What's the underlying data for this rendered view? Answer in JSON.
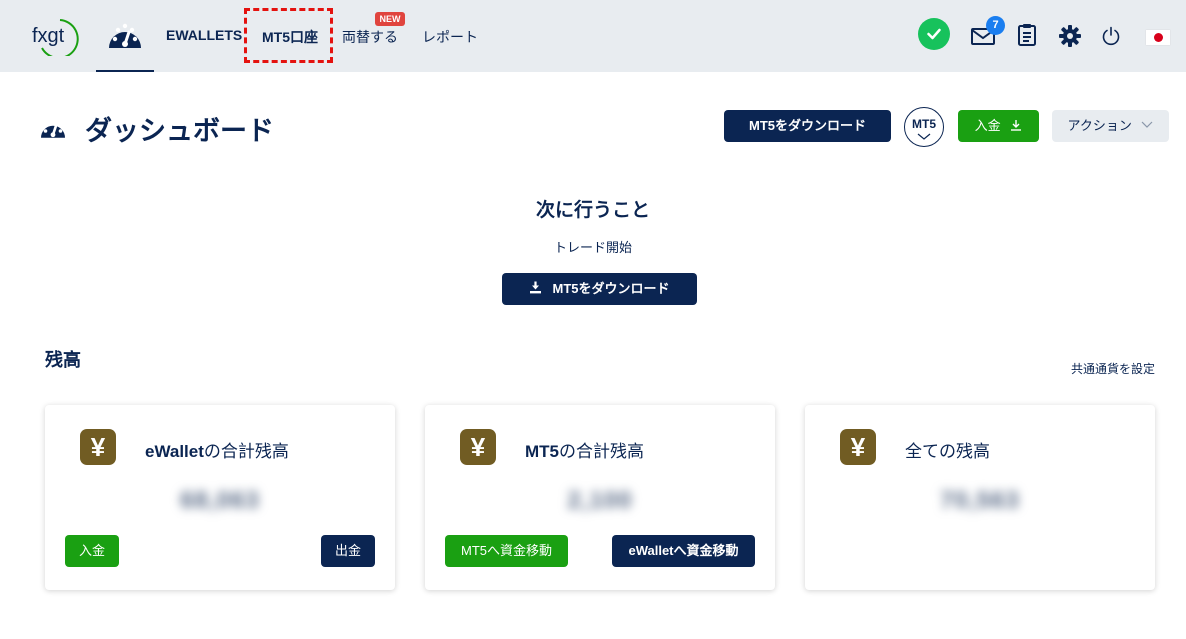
{
  "nav": {
    "logo_text": "fxgt",
    "ewallets": "EWALLETS",
    "mt5_accounts": "MT5口座",
    "exchange": "両替する",
    "exchange_badge": "NEW",
    "reports": "レポート",
    "mail_count": "7"
  },
  "header": {
    "title": "ダッシュボード",
    "download_mt5": "MT5をダウンロード",
    "mt5_selector": "MT5",
    "deposit": "入金",
    "actions": "アクション"
  },
  "next_steps": {
    "title": "次に行うこと",
    "subtitle": "トレード開始",
    "download_button": "MT5をダウンロード"
  },
  "balance": {
    "section_title": "残高",
    "set_currency_link": "共通通貨を設定",
    "cards": [
      {
        "icon": "yen-icon",
        "title_bold": "eWallet",
        "title_rest": "の合計残高",
        "amount": "68,063",
        "buttons": [
          {
            "label": "入金"
          },
          {
            "label": "出金"
          }
        ]
      },
      {
        "icon": "yen-icon",
        "title_bold": "MT5",
        "title_rest": "の合計残高",
        "amount": "2,100",
        "buttons": [
          {
            "label": "MT5へ資金移動"
          },
          {
            "label": "eWalletへ資金移動"
          }
        ]
      },
      {
        "icon": "yen-icon",
        "title_bold": "",
        "title_rest": "全ての残高",
        "amount": "70,563",
        "buttons": []
      }
    ]
  },
  "colors": {
    "navy": "#0b2552",
    "green": "#1aa012",
    "status_green": "#17c25c",
    "badge_red": "#e0443e",
    "highlight_red": "#e4120f",
    "yen_brown": "#715c23"
  }
}
